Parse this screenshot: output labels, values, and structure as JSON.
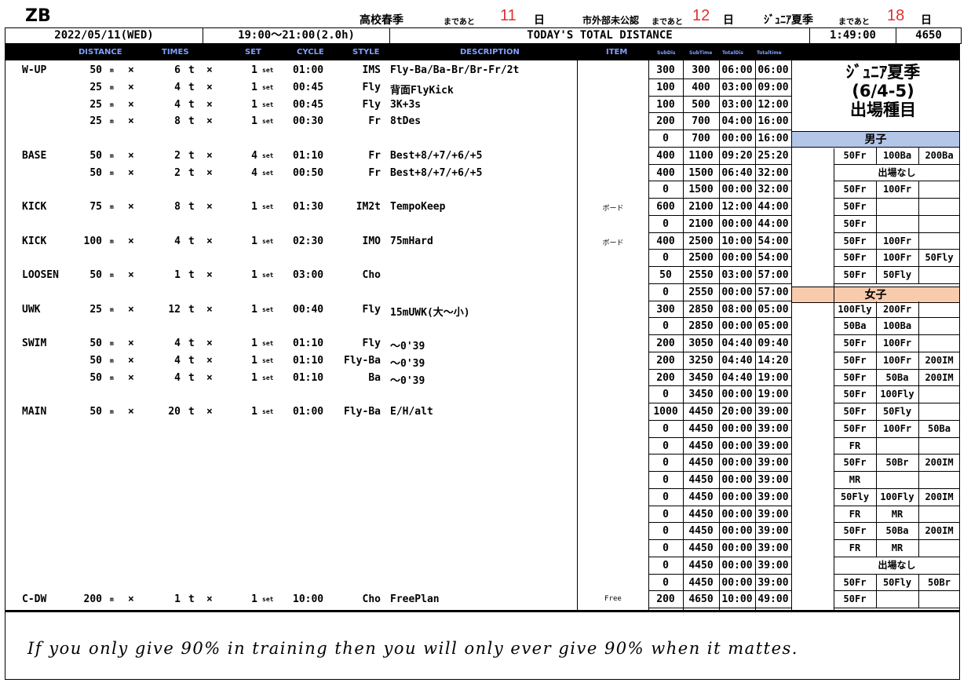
{
  "header": {
    "logo": "ZB",
    "countdowns": [
      {
        "label": "高校春季",
        "suffix": "まであと",
        "days": "11",
        "unit": "日"
      },
      {
        "label": "市外部未公認",
        "suffix": "まであと",
        "days": "12",
        "unit": "日"
      },
      {
        "label": "ｼﾞｭﾆｱ夏季",
        "suffix": "まであと",
        "days": "18",
        "unit": "日"
      }
    ],
    "date": "2022/05/11(WED)",
    "time": "19:00～21:00(2.0h)",
    "total_label": "TODAY'S TOTAL DISTANCE",
    "total_time": "1:49:00",
    "total_distance": "4650"
  },
  "columns": {
    "distance": "DISTANCE",
    "times": "TIMES",
    "set": "SET",
    "cycle": "CYCLE",
    "style": "STYLE",
    "description": "DESCRIPTION",
    "item": "ITEM",
    "subdis": "SubDis",
    "subtime": "SubTime",
    "totaldis": "TotalDis",
    "totaltime": "Totaltime"
  },
  "menu": [
    {
      "cat": "W-UP",
      "dist": "50",
      "times": "6",
      "set": "1",
      "cycle": "01:00",
      "style": "IMS",
      "desc": "Fly-Ba/Ba-Br/Br-Fr/2t",
      "item": ""
    },
    {
      "cat": "",
      "dist": "25",
      "times": "4",
      "set": "1",
      "cycle": "00:45",
      "style": "Fly",
      "desc": "背面FlyKick",
      "item": ""
    },
    {
      "cat": "",
      "dist": "25",
      "times": "4",
      "set": "1",
      "cycle": "00:45",
      "style": "Fly",
      "desc": "3K+3s",
      "item": ""
    },
    {
      "cat": "",
      "dist": "25",
      "times": "8",
      "set": "1",
      "cycle": "00:30",
      "style": "Fr",
      "desc": "8tDes",
      "item": ""
    },
    null,
    {
      "cat": "BASE",
      "dist": "50",
      "times": "2",
      "set": "4",
      "cycle": "01:10",
      "style": "Fr",
      "desc": "Best+8/+7/+6/+5",
      "item": ""
    },
    {
      "cat": "",
      "dist": "50",
      "times": "2",
      "set": "4",
      "cycle": "00:50",
      "style": "Fr",
      "desc": "Best+8/+7/+6/+5",
      "item": ""
    },
    null,
    {
      "cat": "KICK",
      "dist": "75",
      "times": "8",
      "set": "1",
      "cycle": "01:30",
      "style": "IM2t",
      "desc": "TempoKeep",
      "item": "ボード"
    },
    null,
    {
      "cat": "KICK",
      "dist": "100",
      "times": "4",
      "set": "1",
      "cycle": "02:30",
      "style": "IMO",
      "desc": "75mHard",
      "item": "ボード"
    },
    null,
    {
      "cat": "LOOSEN",
      "dist": "50",
      "times": "1",
      "set": "1",
      "cycle": "03:00",
      "style": "Cho",
      "desc": "",
      "item": ""
    },
    null,
    {
      "cat": "UWK",
      "dist": "25",
      "times": "12",
      "set": "1",
      "cycle": "00:40",
      "style": "Fly",
      "desc": "15mUWK(大～小)",
      "item": ""
    },
    null,
    {
      "cat": "SWIM",
      "dist": "50",
      "times": "4",
      "set": "1",
      "cycle": "01:10",
      "style": "Fly",
      "desc": "～0'39",
      "item": ""
    },
    {
      "cat": "",
      "dist": "50",
      "times": "4",
      "set": "1",
      "cycle": "01:10",
      "style": "Fly-Ba",
      "desc": "～0'39",
      "item": ""
    },
    {
      "cat": "",
      "dist": "50",
      "times": "4",
      "set": "1",
      "cycle": "01:10",
      "style": "Ba",
      "desc": "～0'39",
      "item": ""
    },
    null,
    {
      "cat": "MAIN",
      "dist": "50",
      "times": "20",
      "set": "1",
      "cycle": "01:00",
      "style": "Fly-Ba",
      "desc": "E/H/alt",
      "item": ""
    },
    null,
    null,
    null,
    null,
    null,
    null,
    null,
    null,
    null,
    null,
    {
      "cat": "C-DW",
      "dist": "200",
      "times": "1",
      "set": "1",
      "cycle": "10:00",
      "style": "Cho",
      "desc": "FreePlan",
      "item": "Free"
    }
  ],
  "units": {
    "m": "m",
    "x": "×",
    "t": "t",
    "set": "set"
  },
  "sums": [
    [
      "300",
      "300",
      "06:00",
      "06:00"
    ],
    [
      "100",
      "400",
      "03:00",
      "09:00"
    ],
    [
      "100",
      "500",
      "03:00",
      "12:00"
    ],
    [
      "200",
      "700",
      "04:00",
      "16:00"
    ],
    [
      "0",
      "700",
      "00:00",
      "16:00"
    ],
    [
      "400",
      "1100",
      "09:20",
      "25:20"
    ],
    [
      "400",
      "1500",
      "06:40",
      "32:00"
    ],
    [
      "0",
      "1500",
      "00:00",
      "32:00"
    ],
    [
      "600",
      "2100",
      "12:00",
      "44:00"
    ],
    [
      "0",
      "2100",
      "00:00",
      "44:00"
    ],
    [
      "400",
      "2500",
      "10:00",
      "54:00"
    ],
    [
      "0",
      "2500",
      "00:00",
      "54:00"
    ],
    [
      "50",
      "2550",
      "03:00",
      "57:00"
    ],
    [
      "0",
      "2550",
      "00:00",
      "57:00"
    ],
    [
      "300",
      "2850",
      "08:00",
      "05:00"
    ],
    [
      "0",
      "2850",
      "00:00",
      "05:00"
    ],
    [
      "200",
      "3050",
      "04:40",
      "09:40"
    ],
    [
      "200",
      "3250",
      "04:40",
      "14:20"
    ],
    [
      "200",
      "3450",
      "04:40",
      "19:00"
    ],
    [
      "0",
      "3450",
      "00:00",
      "19:00"
    ],
    [
      "1000",
      "4450",
      "20:00",
      "39:00"
    ],
    [
      "0",
      "4450",
      "00:00",
      "39:00"
    ],
    [
      "0",
      "4450",
      "00:00",
      "39:00"
    ],
    [
      "0",
      "4450",
      "00:00",
      "39:00"
    ],
    [
      "0",
      "4450",
      "00:00",
      "39:00"
    ],
    [
      "0",
      "4450",
      "00:00",
      "39:00"
    ],
    [
      "0",
      "4450",
      "00:00",
      "39:00"
    ],
    [
      "0",
      "4450",
      "00:00",
      "39:00"
    ],
    [
      "0",
      "4450",
      "00:00",
      "39:00"
    ],
    [
      "0",
      "4450",
      "00:00",
      "39:00"
    ],
    [
      "0",
      "4450",
      "00:00",
      "39:00"
    ],
    [
      "200",
      "4650",
      "10:00",
      "49:00"
    ]
  ],
  "panel": {
    "title_lines": [
      "ｼﾞｭﾆｱ夏季",
      "(6/4-5)",
      "出場種目"
    ],
    "male_label": "男子",
    "female_label": "女子",
    "male_color": "#b4c6e7",
    "female_color": "#f8cbad",
    "rows": [
      {
        "events": [
          "50Fr",
          "100Ba",
          "200Ba"
        ]
      },
      {
        "span": "出場なし"
      },
      {
        "events": [
          "50Fr",
          "100Fr",
          ""
        ]
      },
      {
        "events": [
          "50Fr",
          "",
          ""
        ]
      },
      {
        "events": [
          "50Fr",
          "",
          ""
        ]
      },
      {
        "events": [
          "50Fr",
          "100Fr",
          ""
        ]
      },
      {
        "events": [
          "50Fr",
          "100Fr",
          "50Fly"
        ]
      },
      {
        "events": [
          "50Fr",
          "50Fly",
          ""
        ]
      },
      {
        "events": [
          "100Fly",
          "200Fr",
          ""
        ]
      },
      {
        "events": [
          "50Ba",
          "100Ba",
          ""
        ]
      },
      {
        "events": [
          "50Fr",
          "100Fr",
          ""
        ]
      },
      {
        "events": [
          "50Fr",
          "100Fr",
          "200IM"
        ]
      },
      {
        "events": [
          "50Fr",
          "50Ba",
          "200IM"
        ]
      },
      {
        "events": [
          "50Fr",
          "100Fly",
          ""
        ]
      },
      {
        "events": [
          "50Fr",
          "50Fly",
          ""
        ]
      },
      {
        "events": [
          "50Fr",
          "100Fr",
          "50Ba"
        ]
      },
      {
        "events": [
          "FR",
          "",
          ""
        ]
      },
      {
        "events": [
          "50Fr",
          "50Br",
          "200IM"
        ]
      },
      {
        "events": [
          "MR",
          "",
          ""
        ]
      },
      {
        "events": [
          "50Fly",
          "100Fly",
          "200IM"
        ]
      },
      {
        "events": [
          "FR",
          "MR",
          ""
        ]
      },
      {
        "events": [
          "50Fr",
          "50Ba",
          "200IM"
        ]
      },
      {
        "events": [
          "FR",
          "MR",
          ""
        ]
      },
      {
        "span": "出場なし"
      },
      {
        "events": [
          "50Fr",
          "50Fly",
          "50Br"
        ]
      },
      {
        "events": [
          "50Fr",
          "",
          ""
        ]
      }
    ]
  },
  "quote": "If you only give 90% in training then you will only ever give 90% when it mattes."
}
